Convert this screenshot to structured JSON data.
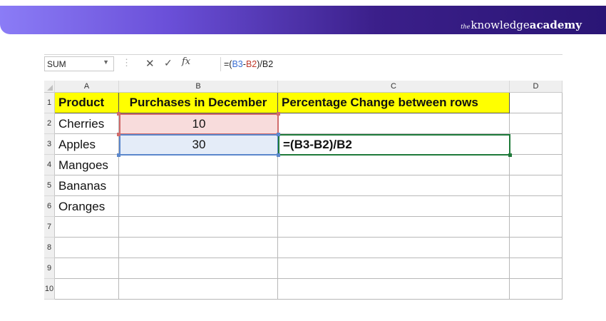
{
  "brand": {
    "the": "the",
    "knowledge": "knowledge",
    "academy": "academy"
  },
  "formula_bar": {
    "name_box": "SUM",
    "cancel_icon": "✕",
    "enter_icon": "✓",
    "fx_label": "fx",
    "formula_parts": [
      "=(",
      "B3",
      "-",
      "B2",
      ")/",
      "B2"
    ]
  },
  "columns": [
    "A",
    "B",
    "C",
    "D"
  ],
  "rows": [
    "1",
    "2",
    "3",
    "4",
    "5",
    "6",
    "7",
    "8",
    "9",
    "10"
  ],
  "cells": {
    "A1": "Product",
    "B1": "Purchases in December",
    "C1": "Percentage Change between rows",
    "A2": "Cherries",
    "B2": "10",
    "A3": "Apples",
    "B3": "30",
    "C3": "=(B3-B2)/B2",
    "A4": "Mangoes",
    "A5": "Bananas",
    "A6": "Oranges"
  },
  "colors": {
    "header_fill": "#ffff00",
    "ref_red": "#c0392b",
    "ref_blue": "#3b6fd4",
    "active_border": "#1f7a3a"
  }
}
